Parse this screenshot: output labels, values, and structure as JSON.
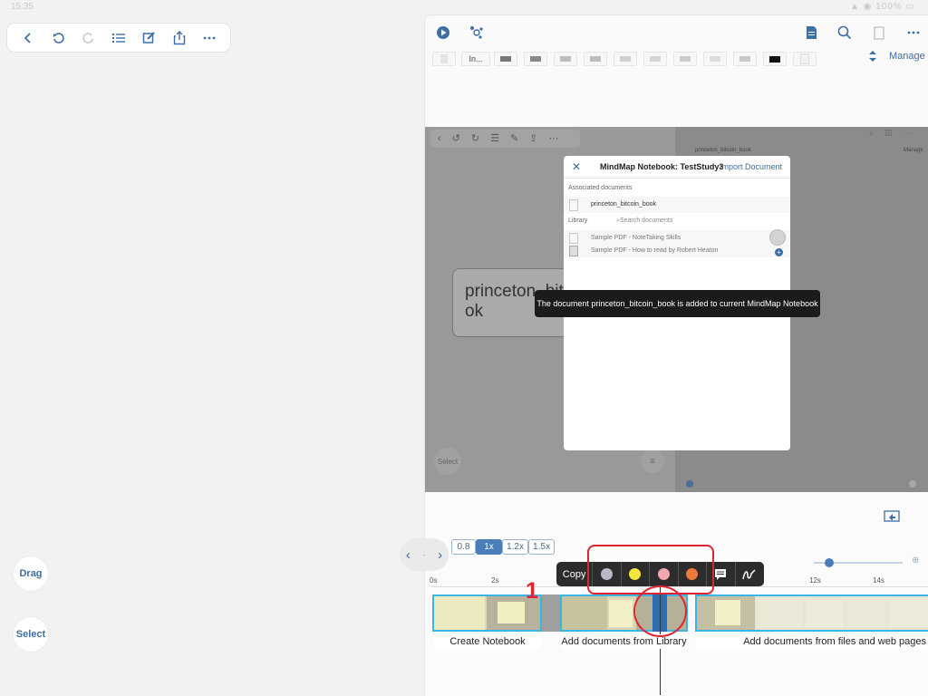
{
  "status": {
    "time": "15:35",
    "battery": "100%"
  },
  "side": {
    "drag": "Drag",
    "select": "Select"
  },
  "tabs": {
    "first_label": "In...",
    "manage": "Manage"
  },
  "video": {
    "modal_title": "MindMap Notebook: TestStudy3",
    "import_link": "Import Document",
    "associated_heading": "Associated documents",
    "associated_doc": "princeton_bitcoin_book",
    "library_heading": "Library",
    "search_placeholder": "Search documents",
    "lib_docs": [
      "Sample PDF - NoteTaking Skills",
      "Sample PDF - How to read by Robert Heaton"
    ],
    "toast": "The document princeton_bitcoin_book is added to current MindMap Notebook",
    "node_text_1": "princeton_bit",
    "node_text_2": "ok",
    "inner_tab": "princeton_bitcoin_book",
    "inner_manage": "Manage",
    "inner_select": "Select"
  },
  "speeds": [
    "0.8",
    "1x",
    "1.2x",
    "1.5x"
  ],
  "ticks": [
    "0s",
    "2s",
    "12s",
    "14s"
  ],
  "copy_label": "Copy",
  "highlight_colors": [
    "#b9b9c9",
    "#f5e63b",
    "#f1a9ad",
    "#f07a3b"
  ],
  "annotation_number": "1",
  "clips": [
    "Create Notebook",
    "Add documents from Library",
    "Add documents from files and web pages"
  ],
  "accent": "#3d6ea5",
  "annotation_color": "#e0242f"
}
